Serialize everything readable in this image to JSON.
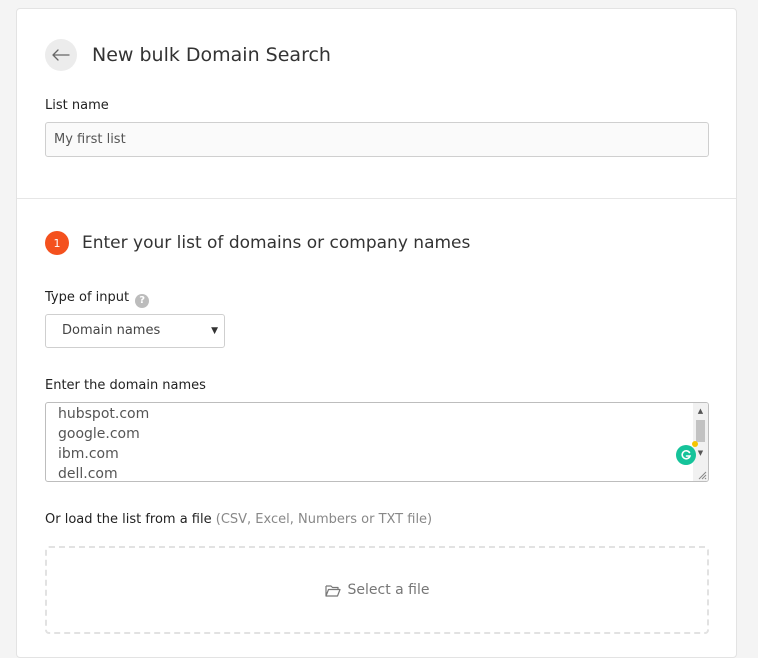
{
  "header": {
    "title": "New bulk Domain Search",
    "back_icon": "arrow-left-icon"
  },
  "list_name": {
    "label": "List name",
    "value": "My first list"
  },
  "step": {
    "number": "1",
    "title": "Enter your list of domains or company names",
    "color": "#f4511e"
  },
  "input_type": {
    "label": "Type of input",
    "help_icon": "question-circle-icon",
    "selected": "Domain names"
  },
  "domains": {
    "label": "Enter the domain names",
    "lines": [
      "hubspot.com",
      "google.com",
      "ibm.com",
      "dell.com"
    ]
  },
  "file_upload": {
    "label": "Or load the list from a file",
    "hint": "(CSV, Excel, Numbers or TXT file)",
    "button_label": "Select a file",
    "icon": "folder-open-icon"
  },
  "colors": {
    "accent": "#f4511e",
    "grammarly": "#15c39a"
  }
}
